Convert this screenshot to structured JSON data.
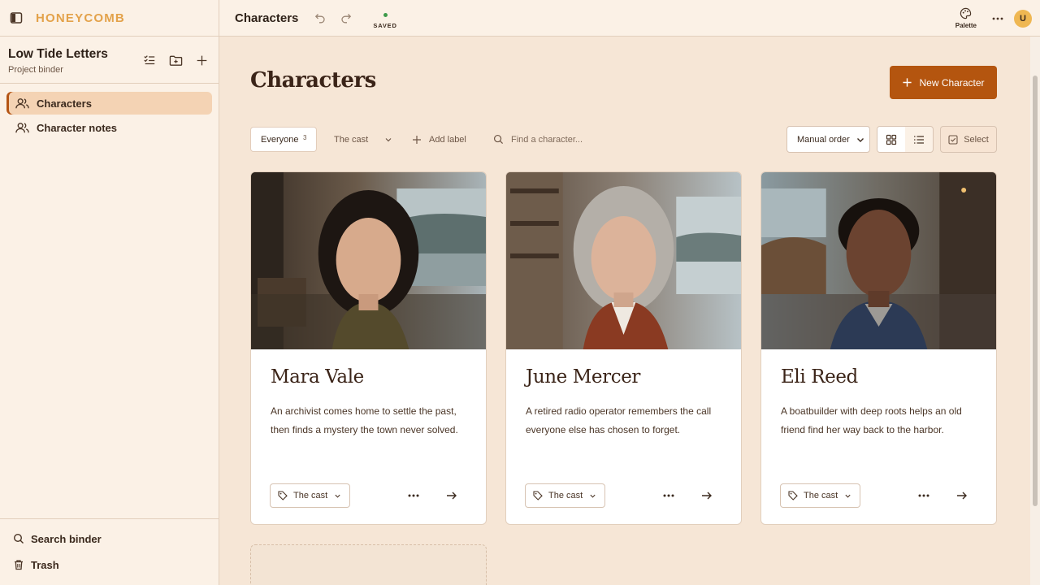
{
  "app": {
    "brand": "HONEYCOMB"
  },
  "sidebar": {
    "project_title": "Low Tide Letters",
    "project_subtitle": "Project binder",
    "items": [
      {
        "label": "Characters",
        "active": true
      },
      {
        "label": "Character notes",
        "active": false
      }
    ],
    "bottom": {
      "search_label": "Search binder",
      "trash_label": "Trash"
    }
  },
  "topbar": {
    "title": "Characters",
    "saved_text": "SAVED",
    "palette_label": "Palette",
    "avatar_initial": "U"
  },
  "main": {
    "title": "Characters",
    "new_button_label": "New Character",
    "filters": {
      "everyone_label": "Everyone",
      "everyone_count": "3",
      "cast_label": "The cast",
      "add_label": "Add label",
      "search_placeholder": "Find a character..."
    },
    "sort_value": "Manual order",
    "select_label": "Select",
    "view_mode": "grid"
  },
  "characters": [
    {
      "name": "Mara Vale",
      "description": "An archivist comes home to settle the past, then finds a mystery the town never solved.",
      "tag": "The cast"
    },
    {
      "name": "June Mercer",
      "description": "A retired radio operator remembers the call everyone else has chosen to forget.",
      "tag": "The cast"
    },
    {
      "name": "Eli Reed",
      "description": "A boatbuilder with deep roots helps an old friend find her way back to the harbor.",
      "tag": "The cast"
    }
  ],
  "colors": {
    "accent": "#b4550f",
    "brand": "#e3a24a",
    "background": "#f6e6d6",
    "sidebar": "#fbf1e6",
    "saved_dot": "#3d9a4a"
  }
}
